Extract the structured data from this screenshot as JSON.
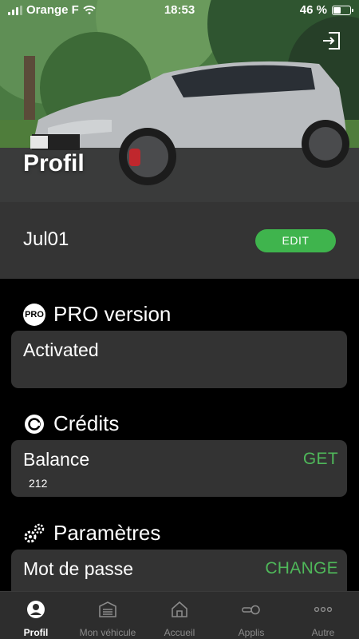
{
  "statusbar": {
    "carrier": "Orange F",
    "time": "18:53",
    "battery": "46 %",
    "battery_level": 0.46
  },
  "header": {
    "title": "Profil",
    "logout_icon": "logout-icon"
  },
  "user": {
    "name": "Jul01",
    "edit_label": "EDIT"
  },
  "pro": {
    "title": "PRO version",
    "badge": "PRO",
    "status": "Activated"
  },
  "credits": {
    "title": "Crédits",
    "balance_label": "Balance",
    "get_label": "GET",
    "balance_value": "212"
  },
  "settings": {
    "title": "Paramètres",
    "password_label": "Mot de passe",
    "change_label": "CHANGE"
  },
  "tabs": [
    {
      "label": "Profil",
      "icon": "user-icon",
      "active": true
    },
    {
      "label": "Mon véhicule",
      "icon": "garage-icon",
      "active": false
    },
    {
      "label": "Accueil",
      "icon": "home-icon",
      "active": false
    },
    {
      "label": "Applis",
      "icon": "key-icon",
      "active": false
    },
    {
      "label": "Autre",
      "icon": "more-icon",
      "active": false
    }
  ],
  "colors": {
    "accent": "#3fb44d",
    "card": "#333333",
    "user_row": "#343434",
    "tabbar": "#2d2d2d"
  }
}
